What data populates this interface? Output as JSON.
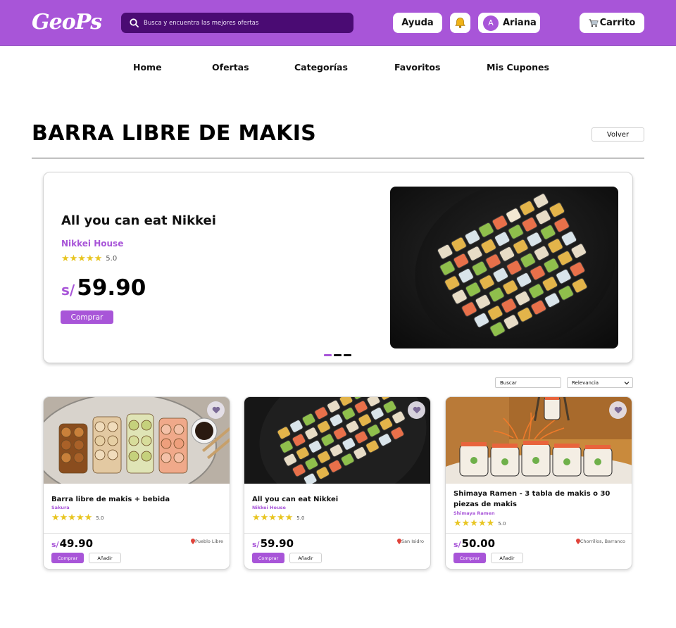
{
  "header": {
    "logo": "GeoPs",
    "search_placeholder": "Busca y encuentra las mejores ofertas",
    "help_label": "Ayuda",
    "user_initial": "A",
    "user_name": "Ariana",
    "cart_label": "Carrito"
  },
  "nav": {
    "items": [
      {
        "label": "Home"
      },
      {
        "label": "Ofertas"
      },
      {
        "label": "Categorías"
      },
      {
        "label": "Favoritos"
      },
      {
        "label": "Mis Cupones"
      }
    ]
  },
  "page": {
    "title": "BARRA LIBRE DE MAKIS",
    "back_label": "Volver"
  },
  "hero": {
    "title": "All you can eat Nikkei",
    "store": "Nikkei House",
    "rating": "5.0",
    "stars": 5,
    "currency": "s/",
    "price": "59.90",
    "buy_label": "Comprar",
    "slides": 3,
    "active_slide": 1
  },
  "filters": {
    "search_placeholder": "Buscar",
    "sort_value": "Relevancia"
  },
  "products": [
    {
      "title": "Barra libre de makis + bebida",
      "store": "Sakura",
      "rating": "5.0",
      "currency": "s/",
      "price": "49.90",
      "location": "Pueblo Libre",
      "buy_label": "Comprar",
      "add_label": "Añadir"
    },
    {
      "title": "All you can eat Nikkei",
      "store": "Nikkei House",
      "rating": "5.0",
      "currency": "s/",
      "price": "59.90",
      "location": "San Isidro",
      "buy_label": "Comprar",
      "add_label": "Añadir"
    },
    {
      "title": "Shimaya Ramen - 3 tabla de makis o 30 piezas de makis",
      "store": "Shimaya Ramen",
      "rating": "5.0",
      "currency": "s/",
      "price": "50.00",
      "location": "Chorrillos, Barranco",
      "buy_label": "Comprar",
      "add_label": "Añadir"
    }
  ],
  "colors": {
    "brand": "#a855d8",
    "search_bg": "#4a0b73",
    "star": "#e8c521"
  },
  "icons": {
    "search": "search-icon",
    "bell": "bell-icon",
    "cart": "cart-icon",
    "favorite": "heart-icon",
    "location": "location-pin-icon",
    "chevron": "chevron-down-icon",
    "star": "star-icon"
  }
}
